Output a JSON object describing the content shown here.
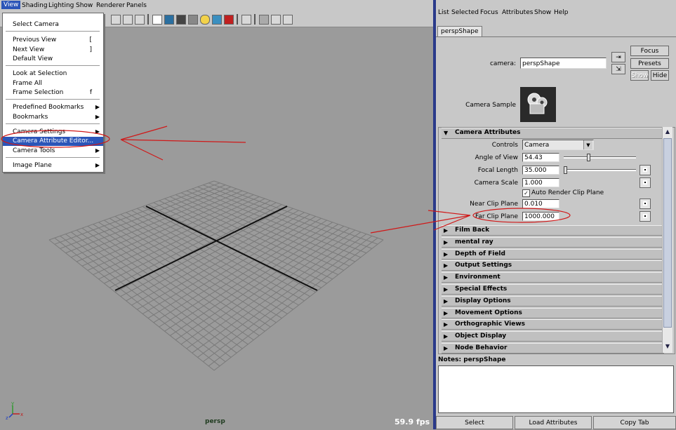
{
  "viewport": {
    "menu": [
      "View",
      "Shading",
      "Lighting",
      "Show",
      "Renderer",
      "Panels"
    ],
    "active_menu": "View",
    "camera_label": "persp",
    "fps": "59.9 fps",
    "axes": {
      "x": "x",
      "y": "y",
      "z": "z"
    }
  },
  "view_menu": {
    "select_camera": "Select Camera",
    "previous_view": "Previous View",
    "previous_view_shortcut": "[",
    "next_view": "Next View",
    "next_view_shortcut": "]",
    "default_view": "Default View",
    "look_at_selection": "Look at Selection",
    "frame_all": "Frame All",
    "frame_selection": "Frame Selection",
    "frame_selection_shortcut": "f",
    "predefined_bookmarks": "Predefined Bookmarks",
    "bookmarks": "Bookmarks",
    "camera_settings": "Camera Settings",
    "camera_attribute_editor": "Camera Attribute Editor...",
    "camera_tools": "Camera Tools",
    "image_plane": "Image Plane"
  },
  "editor": {
    "menu": [
      "List",
      "Selected",
      "Focus",
      "Attributes",
      "Show",
      "Help"
    ],
    "tab": "perspShape",
    "camera_label": "camera:",
    "camera_value": "perspShape",
    "focus_btn": "Focus",
    "presets_btn": "Presets",
    "show_btn": "Show",
    "hide_btn": "Hide",
    "camera_sample_label": "Camera Sample",
    "camera_attributes": {
      "header": "Camera Attributes",
      "controls_label": "Controls",
      "controls_value": "Camera",
      "angle_of_view_label": "Angle of View",
      "angle_of_view_value": "54.43",
      "focal_length_label": "Focal Length",
      "focal_length_value": "35.000",
      "camera_scale_label": "Camera Scale",
      "camera_scale_value": "1.000",
      "auto_render_clip_plane": "Auto Render Clip Plane",
      "auto_render_clip_plane_checked": true,
      "near_clip_label": "Near Clip Plane",
      "near_clip_value": "0.010",
      "far_clip_label": "Far Clip Plane",
      "far_clip_value": "1000.000"
    },
    "sections": [
      "Film Back",
      "mental ray",
      "Depth of Field",
      "Output Settings",
      "Environment",
      "Special Effects",
      "Display Options",
      "Movement Options",
      "Orthographic Views",
      "Object Display",
      "Node Behavior"
    ],
    "notes_label": "Notes:  perspShape",
    "bottom_buttons": {
      "select": "Select",
      "load": "Load Attributes",
      "copy": "Copy Tab"
    }
  },
  "colors": {
    "viewport_bg": "#9b9b9b",
    "highlight": "#2b55b8",
    "annotation_red": "#d01818",
    "divider": "#2a3a8a"
  }
}
